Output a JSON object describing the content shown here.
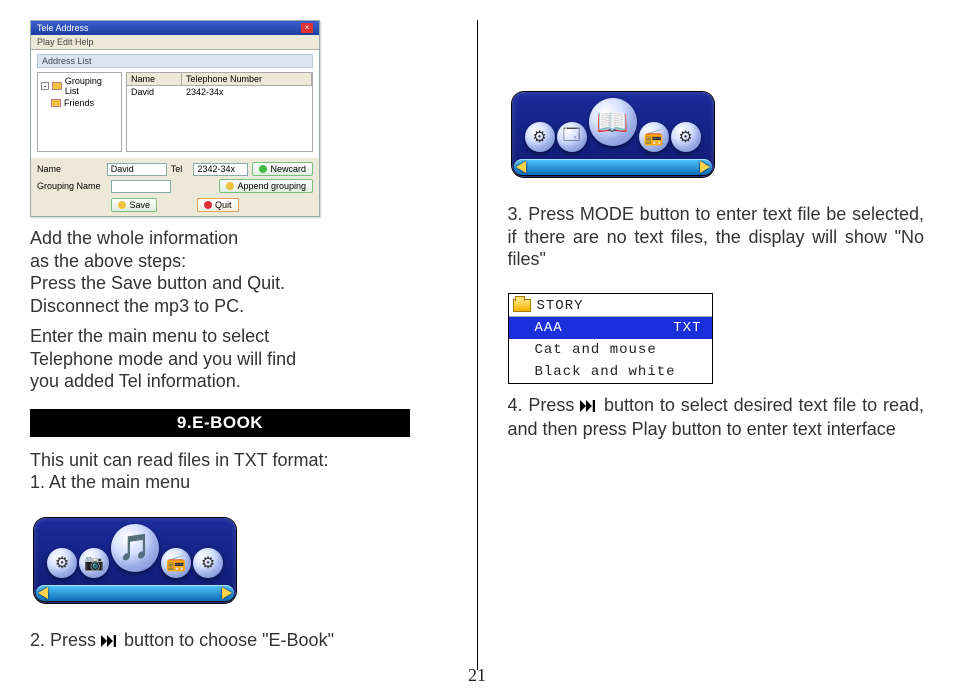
{
  "page_number": "21",
  "left": {
    "address_app": {
      "title": "Tele Address",
      "menu": "Play   Edit   Help",
      "section_label": "Address List",
      "tree": {
        "root": "Grouping List",
        "child": "Friends"
      },
      "table": {
        "headers": [
          "Name",
          "Telephone Number"
        ],
        "row": [
          "David",
          "2342-34x"
        ]
      },
      "fields": {
        "name_label": "Name",
        "name_value": "David",
        "tel_label": "Tel",
        "tel_value": "2342-34x",
        "group_label": "Grouping Name",
        "group_value": "",
        "newcard_btn": "Newcard",
        "append_btn": "Append grouping",
        "save_btn": "Save",
        "quit_btn": "Quit"
      }
    },
    "para1_l1": "Add the whole information",
    "para1_l2": "as the above steps:",
    "para1_l3": "Press the Save button and Quit.",
    "para1_l4": "Disconnect the mp3 to PC.",
    "para2_l1": "Enter the main menu to select",
    "para2_l2": "Telephone mode and you will find",
    "para2_l3": "you added Tel information.",
    "section_header": "9.E-BOOK",
    "ebook_intro": "This unit can read files in TXT format:",
    "ebook_step1": "1. At the main menu",
    "device_icons": {
      "i1": "⚙",
      "i2": "📷",
      "center": "🎵",
      "i4": "📻",
      "i5": "⚙"
    },
    "ebook_step2_a": "2. Press ",
    "ebook_step2_b": " button to choose \"E-Book\""
  },
  "right": {
    "device_icons": {
      "i1": "⚙",
      "i2": "🗔",
      "center": "📖",
      "i4": "📻",
      "i5": "⚙"
    },
    "step3": "3. Press MODE button to enter text file be selected, if there are no text files, the display will show \"No files\"",
    "story": {
      "folder": "STORY",
      "rows": [
        {
          "name": "AAA",
          "ext": "TXT",
          "selected": true
        },
        {
          "name": "Cat and mouse",
          "selected": false
        },
        {
          "name": "Black and white",
          "selected": false
        }
      ]
    },
    "step4_a": "4. Press ",
    "step4_b": " button to select desired text file to read, and then press Play button to enter text interface"
  }
}
